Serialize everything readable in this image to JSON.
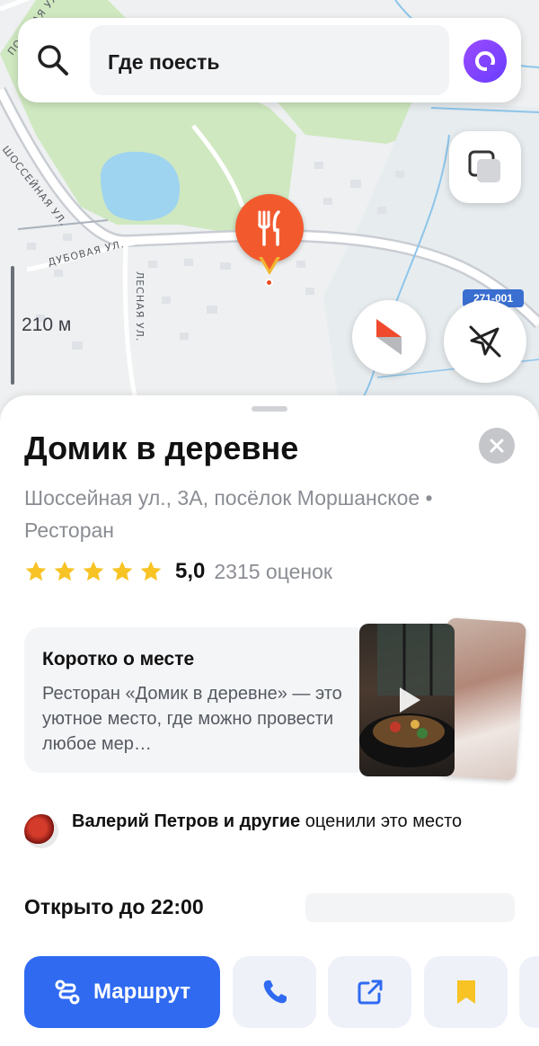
{
  "map": {
    "streets": {
      "shosseynaya": "ШОССЕЙНАЯ УЛ.",
      "dubovaya": "ДУБОВАЯ УЛ.",
      "lesnaya": "ЛЕСНАЯ УЛ.",
      "polevaya": "ПОЛЕВАЯ УЛ."
    },
    "road_badge": "271-001",
    "scale_label": "210 м",
    "pin_icon": "fork-knife-icon"
  },
  "search": {
    "query": "Где поесть"
  },
  "place": {
    "title": "Домик в деревне",
    "address": "Шоссейная ул., 3А, посёлок Моршанское • Ресторан",
    "rating": "5,0",
    "rating_count": "2315 оценок",
    "stars_filled": 5,
    "about": {
      "title": "Коротко о месте",
      "text": "Ресторан «Домик в деревне» — это уютное место, где можно провести любое мер…"
    },
    "friends": {
      "names": "Валерий Петров и другие",
      "suffix": " оценили это место"
    },
    "hours": "Открыто до 22:00"
  },
  "actions": {
    "route_label": "Маршрут"
  },
  "colors": {
    "accent": "#2f6af1",
    "pin": "#f25a2e",
    "star": "#f7c325",
    "alice": "#7a45ff"
  }
}
